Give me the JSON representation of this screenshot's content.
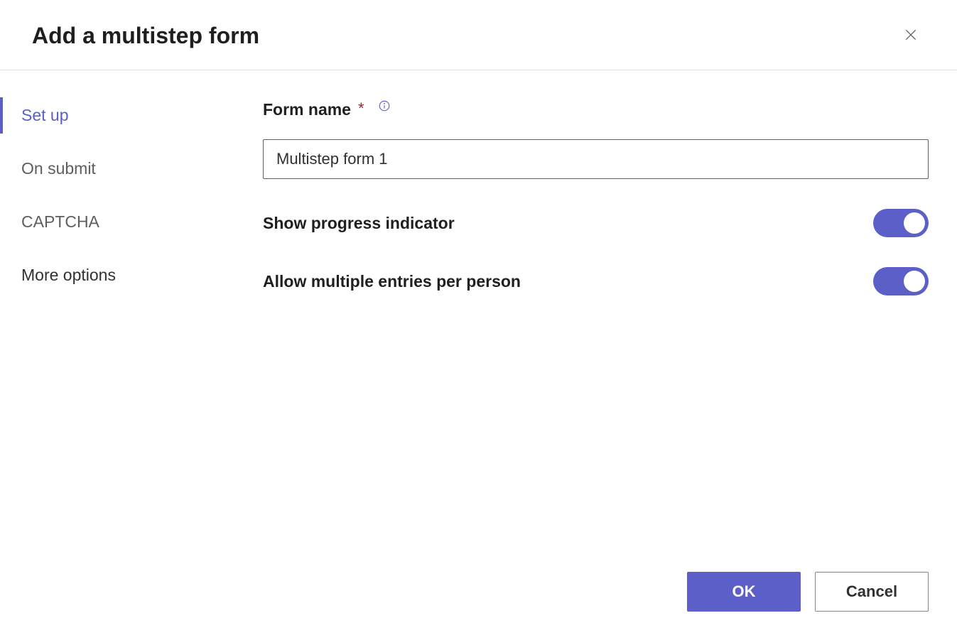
{
  "dialog": {
    "title": "Add a multistep form"
  },
  "sidebar": {
    "items": [
      {
        "label": "Set up",
        "active": true
      },
      {
        "label": "On submit",
        "active": false
      },
      {
        "label": "CAPTCHA",
        "active": false
      },
      {
        "label": "More options",
        "active": false
      }
    ]
  },
  "form": {
    "name_label": "Form name",
    "name_value": "Multistep form 1",
    "required_mark": "*",
    "toggle1_label": "Show progress indicator",
    "toggle1_value": true,
    "toggle2_label": "Allow multiple entries per person",
    "toggle2_value": true
  },
  "footer": {
    "ok_label": "OK",
    "cancel_label": "Cancel"
  }
}
